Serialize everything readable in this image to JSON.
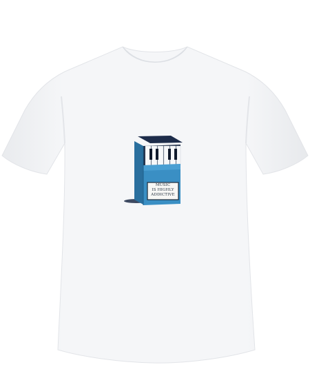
{
  "product": {
    "garment_color": "#f4f5f7",
    "print": {
      "design": "piano-keys-cigarette-pack-icon",
      "pack_color": "#3a8fc4",
      "label_lines": [
        "MUSIC",
        "IS HIGHLY",
        "ADDICTIVE"
      ]
    }
  }
}
